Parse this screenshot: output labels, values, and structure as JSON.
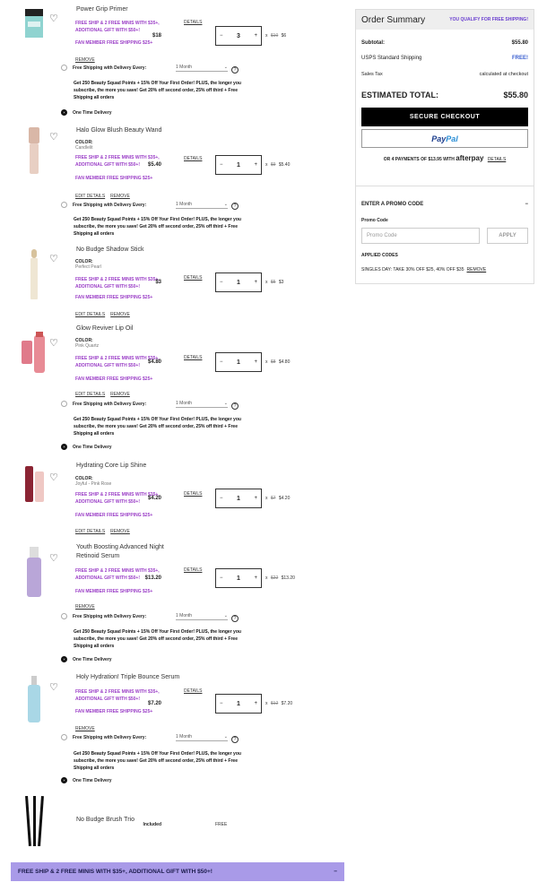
{
  "items": [
    {
      "name": "Power Grip Primer",
      "color_label": "",
      "color": "",
      "promo": "FREE SHIP & 2 FREE MINIS WITH $35+, ADDITIONAL GIFT WITH $50+!",
      "details": "DETAILS",
      "fan": "FAN MEMBER FREE SHIPPING $25+",
      "links": [
        "REMOVE"
      ],
      "qty": "3",
      "orig_price": "$10",
      "price": "$6",
      "total": "$18",
      "subscription": true
    },
    {
      "name": "Halo Glow Blush Beauty Wand",
      "color_label": "COLOR:",
      "color": "Candlelit",
      "promo": "FREE SHIP & 2 FREE MINIS WITH $35+, ADDITIONAL GIFT WITH $50+!",
      "details": "DETAILS",
      "fan": "FAN MEMBER FREE SHIPPING $25+",
      "links": [
        "EDIT DETAILS",
        "REMOVE"
      ],
      "qty": "1",
      "orig_price": "$9",
      "price": "$5.40",
      "total": "$5.40",
      "subscription": true
    },
    {
      "name": "No Budge Shadow Stick",
      "color_label": "COLOR:",
      "color": "Perfect Pearl",
      "promo": "FREE SHIP & 2 FREE MINIS WITH $35+, ADDITIONAL GIFT WITH $50+!",
      "details": "DETAILS",
      "fan": "FAN MEMBER FREE SHIPPING $25+",
      "links": [
        "EDIT DETAILS",
        "REMOVE"
      ],
      "qty": "1",
      "orig_price": "$5",
      "price": "$3",
      "total": "$3",
      "subscription": false
    },
    {
      "name": "Glow Reviver Lip Oil",
      "color_label": "COLOR:",
      "color": "Pink Quartz",
      "promo": "FREE SHIP & 2 FREE MINIS WITH $35+, ADDITIONAL GIFT WITH $50+!",
      "details": "DETAILS",
      "fan": "FAN MEMBER FREE SHIPPING $25+",
      "links": [
        "EDIT DETAILS",
        "REMOVE"
      ],
      "qty": "1",
      "orig_price": "$8",
      "price": "$4.80",
      "total": "$4.80",
      "subscription": true
    },
    {
      "name": "Hydrating Core Lip Shine",
      "color_label": "COLOR:",
      "color": "Joyful - Pink Rose",
      "promo": "FREE SHIP & 2 FREE MINIS WITH $35+, ADDITIONAL GIFT WITH $50+!",
      "details": "DETAILS",
      "fan": "FAN MEMBER FREE SHIPPING $25+",
      "links": [
        "EDIT DETAILS",
        "REMOVE"
      ],
      "qty": "1",
      "orig_price": "$7",
      "price": "$4.20",
      "total": "$4.20",
      "subscription": false
    },
    {
      "name": "Youth Boosting Advanced Night Retinoid Serum",
      "color_label": "",
      "color": "",
      "promo": "FREE SHIP & 2 FREE MINIS WITH $35+, ADDITIONAL GIFT WITH $50+!",
      "details": "DETAILS",
      "fan": "FAN MEMBER FREE SHIPPING $25+",
      "links": [
        "REMOVE"
      ],
      "qty": "1",
      "orig_price": "$22",
      "price": "$13.20",
      "total": "$13.20",
      "subscription": true
    },
    {
      "name": "Holy Hydration! Triple Bounce Serum",
      "color_label": "",
      "color": "",
      "promo": "FREE SHIP & 2 FREE MINIS WITH $35+, ADDITIONAL GIFT WITH $50+!",
      "details": "DETAILS",
      "fan": "FAN MEMBER FREE SHIPPING $25+",
      "links": [
        "REMOVE"
      ],
      "qty": "1",
      "orig_price": "$12",
      "price": "$7.20",
      "total": "$7.20",
      "subscription": true
    }
  ],
  "free_item": {
    "name": "No Budge Brush Trio",
    "price": "FREE",
    "total": "Included"
  },
  "subscription": {
    "label": "Free Shipping with Delivery Every:",
    "frequency": "1 Month",
    "text": "Get 250 Beauty Squad Points + 15% Off Your First Order! PLUS, the longer you subscribe, the more you save! Get 20% off second order, 25% off third + Free Shipping all orders",
    "one_time": "One Time Delivery"
  },
  "summary": {
    "title": "Order Summary",
    "qualify": "YOU QUALIFY FOR FREE SHIPPING!",
    "subtotal_label": "Subtotal:",
    "subtotal": "$55.80",
    "shipping_label": "USPS Standard Shipping",
    "shipping": "FREE!",
    "tax_label": "Sales Tax",
    "tax": "calculated at checkout",
    "est_label": "ESTIMATED TOTAL:",
    "est": "$55.80",
    "checkout": "SECURE CHECKOUT",
    "paypal_a": "Pay",
    "paypal_b": "Pal",
    "afterpay_text": "OR 4 PAYMENTS OF $13.95 WITH",
    "afterpay_logo": "afterpay",
    "afterpay_details": "DETAILS",
    "promo_heading": "ENTER A PROMO CODE",
    "promo_label": "Promo Code",
    "promo_placeholder": "Promo Code",
    "apply": "APPLY",
    "applied_label": "APPLIED CODES",
    "applied_code": "SINGLES DAY: TAKE 30% OFF $25, 40% OFF $35",
    "applied_remove": "REMOVE"
  },
  "banner": {
    "text": "FREE SHIP & 2 FREE MINIS WITH $35+, ADDITIONAL GIFT WITH $50+!",
    "toggle": "−"
  },
  "colors": {
    "promo_purple": "#9b3fc7",
    "qualify_blue": "#6a3fd0",
    "banner_bg": "#a99ae8",
    "checkout_bg": "#000000"
  }
}
